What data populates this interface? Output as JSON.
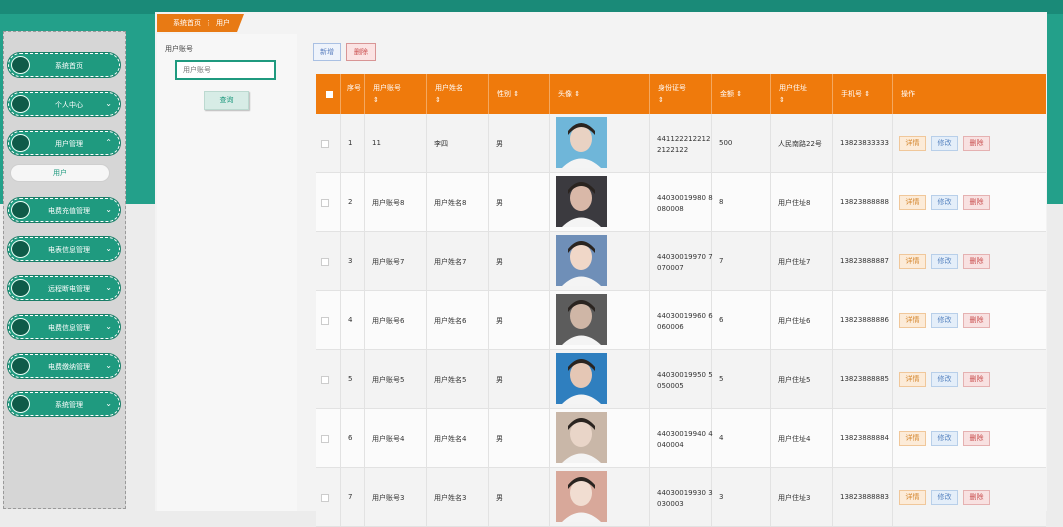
{
  "breadcrumb": {
    "home": "系统首页",
    "separator": "⋮",
    "current": "用户"
  },
  "sidebar": {
    "items": [
      {
        "label": "系统首页",
        "chevron": false
      },
      {
        "label": "个人中心",
        "chevron": true
      },
      {
        "label": "用户管理",
        "chevron": true,
        "expanded": true
      },
      {
        "label": "电费充值管理",
        "chevron": true
      },
      {
        "label": "电表信息管理",
        "chevron": true
      },
      {
        "label": "远程断电管理",
        "chevron": true
      },
      {
        "label": "电费信息管理",
        "chevron": true
      },
      {
        "label": "电费缴纳管理",
        "chevron": true
      },
      {
        "label": "系统管理",
        "chevron": true
      }
    ],
    "sub_item": "用户"
  },
  "search": {
    "label": "用户账号",
    "placeholder": "用户账号",
    "button": "查询"
  },
  "toolbar": {
    "add": "新增",
    "delete": "删除"
  },
  "table": {
    "headers": [
      "序号",
      "用户账号",
      "用户姓名",
      "性别",
      "头像",
      "身份证号",
      "金额",
      "用户住址",
      "手机号",
      "操作"
    ],
    "sort_glyph": "⇕",
    "actions": {
      "detail": "详情",
      "edit": "修改",
      "remove": "删除"
    },
    "rows": [
      {
        "no": "1",
        "account": "11",
        "name": "李四",
        "gender": "男",
        "id": "441122212212 2122122",
        "amount": "500",
        "address": "人民南路22号",
        "phone": "13823833333"
      },
      {
        "no": "2",
        "account": "用户账号8",
        "name": "用户姓名8",
        "gender": "男",
        "id": "44030019980 8080008",
        "amount": "8",
        "address": "用户住址8",
        "phone": "13823888888"
      },
      {
        "no": "3",
        "account": "用户账号7",
        "name": "用户姓名7",
        "gender": "男",
        "id": "44030019970 7070007",
        "amount": "7",
        "address": "用户住址7",
        "phone": "13823888887"
      },
      {
        "no": "4",
        "account": "用户账号6",
        "name": "用户姓名6",
        "gender": "男",
        "id": "44030019960 6060006",
        "amount": "6",
        "address": "用户住址6",
        "phone": "13823888886"
      },
      {
        "no": "5",
        "account": "用户账号5",
        "name": "用户姓名5",
        "gender": "男",
        "id": "44030019950 5050005",
        "amount": "5",
        "address": "用户住址5",
        "phone": "13823888885"
      },
      {
        "no": "6",
        "account": "用户账号4",
        "name": "用户姓名4",
        "gender": "男",
        "id": "44030019940 4040004",
        "amount": "4",
        "address": "用户住址4",
        "phone": "13823888884"
      },
      {
        "no": "7",
        "account": "用户账号3",
        "name": "用户姓名3",
        "gender": "男",
        "id": "44030019930 3030003",
        "amount": "3",
        "address": "用户住址3",
        "phone": "13823888883"
      }
    ]
  },
  "colors": {
    "accent": "#1f9a7f",
    "header": "#ef7a0c"
  }
}
